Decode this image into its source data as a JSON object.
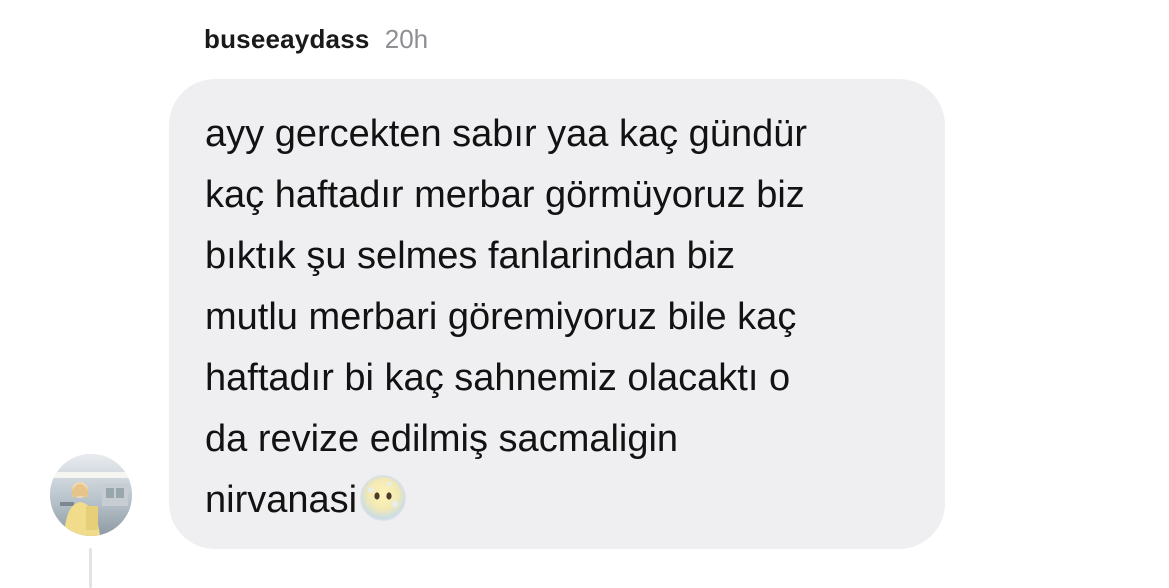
{
  "comment": {
    "username": "buseeaydass",
    "timestamp": "20h",
    "text_lines": [
      "ayy gercekten sabır yaa kaç gündür",
      "kaç haftadır merbar görmüyoruz biz",
      "bıktık şu selmes fanlarindan biz",
      "mutlu merbari göremiyoruz bile kaç",
      "haftadır bi kaç sahnemiz olacaktı o",
      "da revize edilmiş sacmaligin",
      "nirvanasi"
    ],
    "emoji": "face-with-no-mouth-icon"
  },
  "colors": {
    "bubble_bg": "#efeff1",
    "timestamp": "#8e8e93",
    "text": "#121212"
  }
}
